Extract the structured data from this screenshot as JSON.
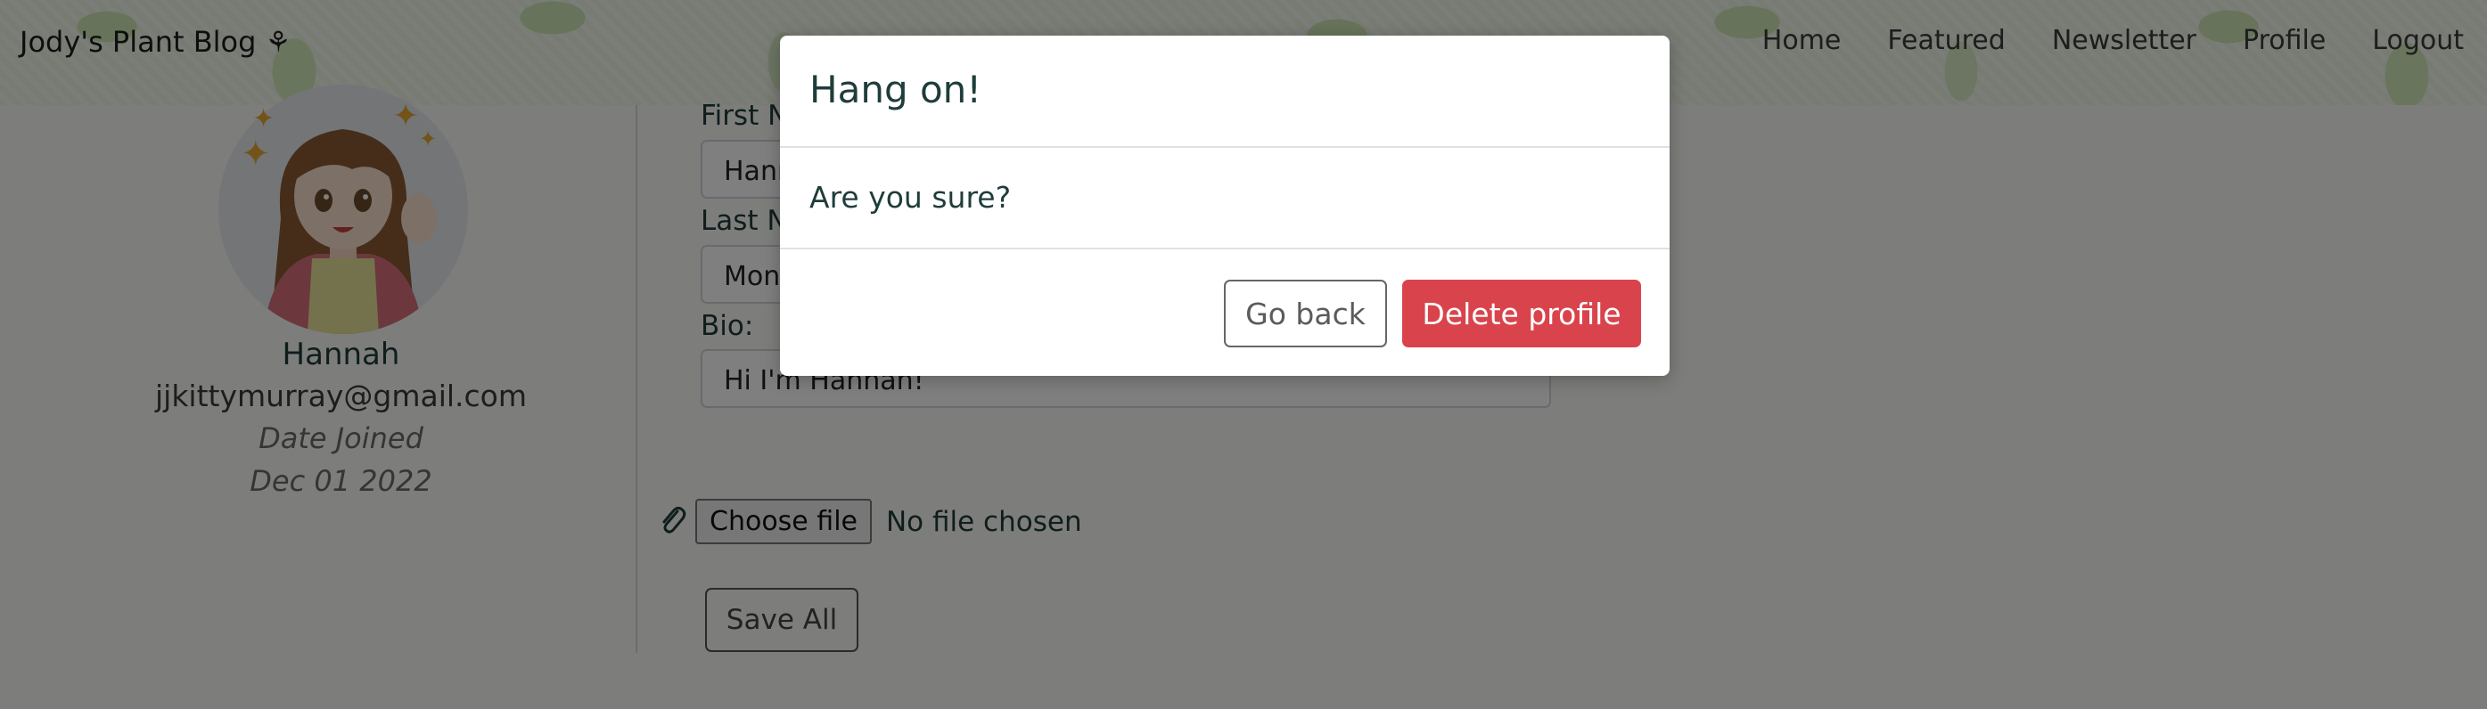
{
  "navbar": {
    "brand": "Jody's Plant Blog ⚘",
    "links": [
      "Home",
      "Featured",
      "Newsletter",
      "Profile",
      "Logout"
    ]
  },
  "profile": {
    "name": "Hannah",
    "email": "jjkittymurray@gmail.com",
    "joined_label": "Date Joined",
    "joined_date": "Dec 01 2022"
  },
  "form": {
    "first_name_label": "First N",
    "first_name_value": "Hann",
    "last_name_label": "Last N",
    "last_name_value": "Mon",
    "bio_label": "Bio:",
    "bio_value": "Hi I'm Hannah!",
    "file_button": "Choose file",
    "file_status": "No file chosen",
    "save_label": "Save All"
  },
  "modal": {
    "title": "Hang on!",
    "body": "Are you sure?",
    "cancel_label": "Go back",
    "confirm_label": "Delete profile"
  },
  "colors": {
    "accent_text": "#1f3d3a",
    "danger": "#d9444c",
    "backdrop": "rgba(0,0,0,0.5)"
  }
}
